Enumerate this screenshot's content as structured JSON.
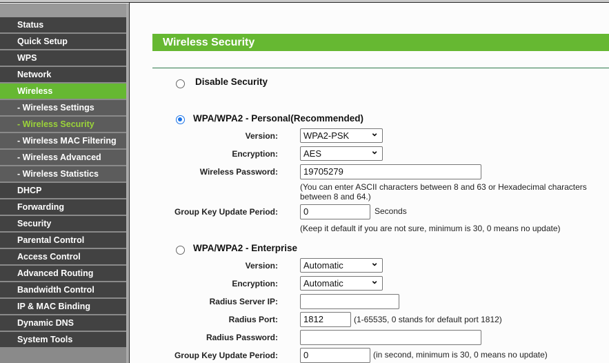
{
  "sidebar": {
    "items": [
      {
        "label": "Status"
      },
      {
        "label": "Quick Setup"
      },
      {
        "label": "WPS"
      },
      {
        "label": "Network"
      },
      {
        "label": "Wireless"
      },
      {
        "label": "- Wireless Settings"
      },
      {
        "label": "- Wireless Security"
      },
      {
        "label": "- Wireless MAC Filtering"
      },
      {
        "label": "- Wireless Advanced"
      },
      {
        "label": "- Wireless Statistics"
      },
      {
        "label": "DHCP"
      },
      {
        "label": "Forwarding"
      },
      {
        "label": "Security"
      },
      {
        "label": "Parental Control"
      },
      {
        "label": "Access Control"
      },
      {
        "label": "Advanced Routing"
      },
      {
        "label": "Bandwidth Control"
      },
      {
        "label": "IP & MAC Binding"
      },
      {
        "label": "Dynamic DNS"
      },
      {
        "label": "System Tools"
      }
    ]
  },
  "page": {
    "title": "Wireless Security"
  },
  "disable": {
    "label": "Disable Security"
  },
  "personal": {
    "label": "WPA/WPA2 - Personal(Recommended)",
    "version_label": "Version:",
    "version": "WPA2-PSK",
    "encryption_label": "Encryption:",
    "encryption": "AES",
    "password_label": "Wireless Password:",
    "password": "19705279",
    "password_note": "(You can enter ASCII characters between 8 and 63 or Hexadecimal characters between 8 and 64.)",
    "gkup_label": "Group Key Update Period:",
    "gkup": "0",
    "gkup_unit": "Seconds",
    "gkup_note": "(Keep it default if you are not sure, minimum is 30, 0 means no update)"
  },
  "enterprise": {
    "label": "WPA/WPA2 - Enterprise",
    "version_label": "Version:",
    "version": "Automatic",
    "encryption_label": "Encryption:",
    "encryption": "Automatic",
    "radius_ip_label": "Radius Server IP:",
    "radius_ip": "",
    "radius_port_label": "Radius Port:",
    "radius_port": "1812",
    "radius_port_note": "(1-65535, 0 stands for default port 1812)",
    "radius_pw_label": "Radius Password:",
    "radius_pw": "",
    "gkup_label": "Group Key Update Period:",
    "gkup": "0",
    "gkup_note": "(in second, minimum is 30, 0 means no update)"
  }
}
